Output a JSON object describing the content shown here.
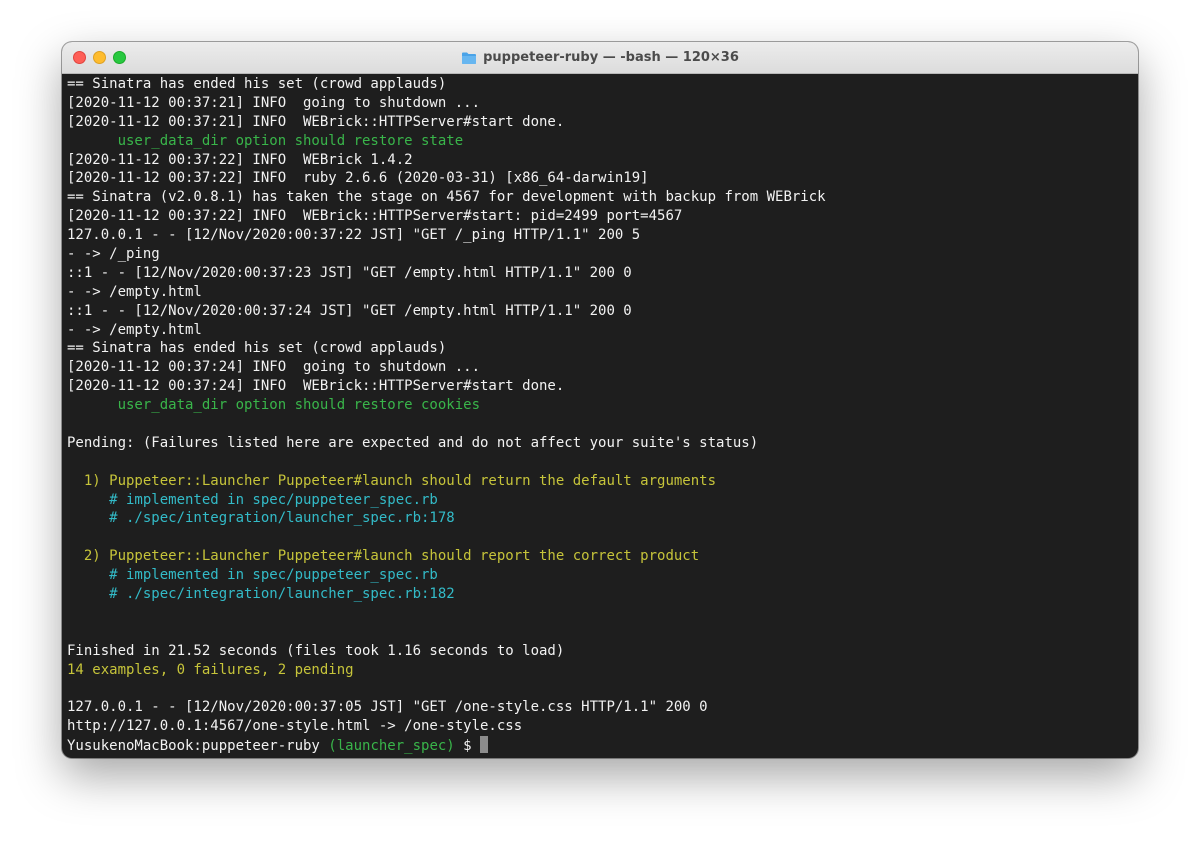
{
  "window": {
    "title": "puppeteer-ruby — -bash — 120×36"
  },
  "terminal": {
    "lines": [
      {
        "color": "default",
        "text": "== Sinatra has ended his set (crowd applauds)"
      },
      {
        "color": "default",
        "text": "[2020-11-12 00:37:21] INFO  going to shutdown ..."
      },
      {
        "color": "default",
        "text": "[2020-11-12 00:37:21] INFO  WEBrick::HTTPServer#start done."
      },
      {
        "color": "green",
        "text": "      user_data_dir option should restore state"
      },
      {
        "color": "default",
        "text": "[2020-11-12 00:37:22] INFO  WEBrick 1.4.2"
      },
      {
        "color": "default",
        "text": "[2020-11-12 00:37:22] INFO  ruby 2.6.6 (2020-03-31) [x86_64-darwin19]"
      },
      {
        "color": "default",
        "text": "== Sinatra (v2.0.8.1) has taken the stage on 4567 for development with backup from WEBrick"
      },
      {
        "color": "default",
        "text": "[2020-11-12 00:37:22] INFO  WEBrick::HTTPServer#start: pid=2499 port=4567"
      },
      {
        "color": "default",
        "text": "127.0.0.1 - - [12/Nov/2020:00:37:22 JST] \"GET /_ping HTTP/1.1\" 200 5"
      },
      {
        "color": "default",
        "text": "- -> /_ping"
      },
      {
        "color": "default",
        "text": "::1 - - [12/Nov/2020:00:37:23 JST] \"GET /empty.html HTTP/1.1\" 200 0"
      },
      {
        "color": "default",
        "text": "- -> /empty.html"
      },
      {
        "color": "default",
        "text": "::1 - - [12/Nov/2020:00:37:24 JST] \"GET /empty.html HTTP/1.1\" 200 0"
      },
      {
        "color": "default",
        "text": "- -> /empty.html"
      },
      {
        "color": "default",
        "text": "== Sinatra has ended his set (crowd applauds)"
      },
      {
        "color": "default",
        "text": "[2020-11-12 00:37:24] INFO  going to shutdown ..."
      },
      {
        "color": "default",
        "text": "[2020-11-12 00:37:24] INFO  WEBrick::HTTPServer#start done."
      },
      {
        "color": "green",
        "text": "      user_data_dir option should restore cookies"
      },
      {
        "color": "default",
        "text": ""
      },
      {
        "color": "default",
        "text": "Pending: (Failures listed here are expected and do not affect your suite's status)"
      },
      {
        "color": "default",
        "text": ""
      },
      {
        "color": "yellow",
        "text": "  1) Puppeteer::Launcher Puppeteer#launch should return the default arguments"
      },
      {
        "color": "cyan",
        "text": "     # implemented in spec/puppeteer_spec.rb"
      },
      {
        "color": "cyan",
        "text": "     # ./spec/integration/launcher_spec.rb:178"
      },
      {
        "color": "default",
        "text": ""
      },
      {
        "color": "yellow",
        "text": "  2) Puppeteer::Launcher Puppeteer#launch should report the correct product"
      },
      {
        "color": "cyan",
        "text": "     # implemented in spec/puppeteer_spec.rb"
      },
      {
        "color": "cyan",
        "text": "     # ./spec/integration/launcher_spec.rb:182"
      },
      {
        "color": "default",
        "text": ""
      },
      {
        "color": "default",
        "text": ""
      },
      {
        "color": "default",
        "text": "Finished in 21.52 seconds (files took 1.16 seconds to load)"
      },
      {
        "color": "yellow",
        "text": "14 examples, 0 failures, 2 pending"
      },
      {
        "color": "default",
        "text": ""
      },
      {
        "color": "default",
        "text": "127.0.0.1 - - [12/Nov/2020:00:37:05 JST] \"GET /one-style.css HTTP/1.1\" 200 0"
      },
      {
        "color": "default",
        "text": "http://127.0.0.1:4567/one-style.html -> /one-style.css"
      }
    ],
    "prompt": {
      "host_dir": "YusukenoMacBook:puppeteer-ruby ",
      "branch": "(launcher_spec)",
      "symbol": " $ "
    }
  },
  "colors": {
    "background": "#1e1e1e",
    "default": "#f2f2f2",
    "green": "#39b54a",
    "yellow": "#c6c43a",
    "cyan": "#33bbc8",
    "folder_icon": "#4aa3e8"
  },
  "icons": {
    "title": "folder-icon"
  }
}
